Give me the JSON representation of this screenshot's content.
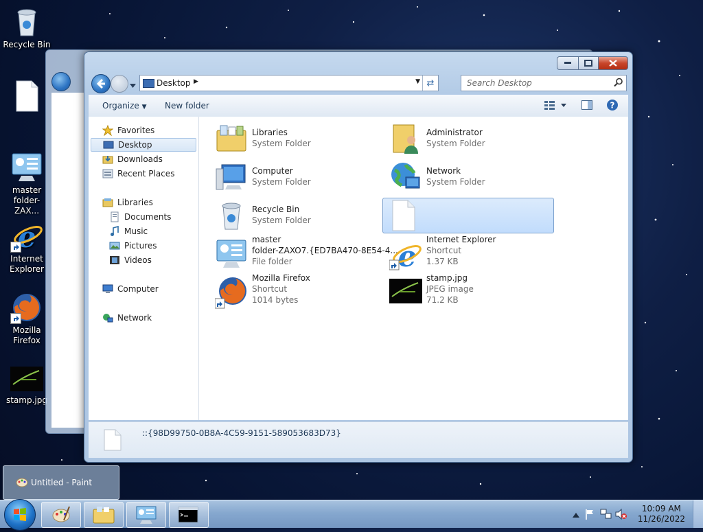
{
  "desktop": {
    "icons": [
      {
        "label": "Recycle Bin"
      },
      {
        "label": ""
      },
      {
        "label": "master folder-ZAX..."
      },
      {
        "label": "Internet Explorer"
      },
      {
        "label": "Mozilla Firefox"
      },
      {
        "label": "stamp.jpg"
      }
    ]
  },
  "explorer": {
    "address": "Desktop",
    "search_placeholder": "Search Desktop",
    "toolbar": {
      "organize": "Organize",
      "new_folder": "New folder"
    },
    "nav": {
      "favorites": "Favorites",
      "desktop": "Desktop",
      "downloads": "Downloads",
      "recent": "Recent Places",
      "libraries": "Libraries",
      "documents": "Documents",
      "music": "Music",
      "pictures": "Pictures",
      "videos": "Videos",
      "computer": "Computer",
      "network": "Network"
    },
    "items": [
      {
        "name": "Libraries",
        "type": "System Folder"
      },
      {
        "name": "Administrator",
        "type": "System Folder"
      },
      {
        "name": "Computer",
        "type": "System Folder"
      },
      {
        "name": "Network",
        "type": "System Folder"
      },
      {
        "name": "Recycle Bin",
        "type": "System Folder"
      },
      {
        "name": ""
      },
      {
        "name": "master",
        "name2": "folder-ZAXO7.{ED7BA470-8E54-4...",
        "type": "File folder"
      },
      {
        "name": "Internet Explorer",
        "type": "Shortcut",
        "size": "1.37 KB"
      },
      {
        "name": "Mozilla Firefox",
        "type": "Shortcut",
        "size": "1014 bytes"
      },
      {
        "name": "stamp.jpg",
        "type": "JPEG image",
        "size": "71.2 KB"
      }
    ],
    "details_text": "::{98D99750-0B8A-4C59-9151-589053683D73}"
  },
  "taskbar": {
    "paint_thumb": "Untitled - Paint",
    "time": "10:09 AM",
    "date": "11/26/2022"
  },
  "colors": {
    "selection": "#cce4fc",
    "taskbar": "#86a8cf",
    "close": "#c8462b"
  }
}
